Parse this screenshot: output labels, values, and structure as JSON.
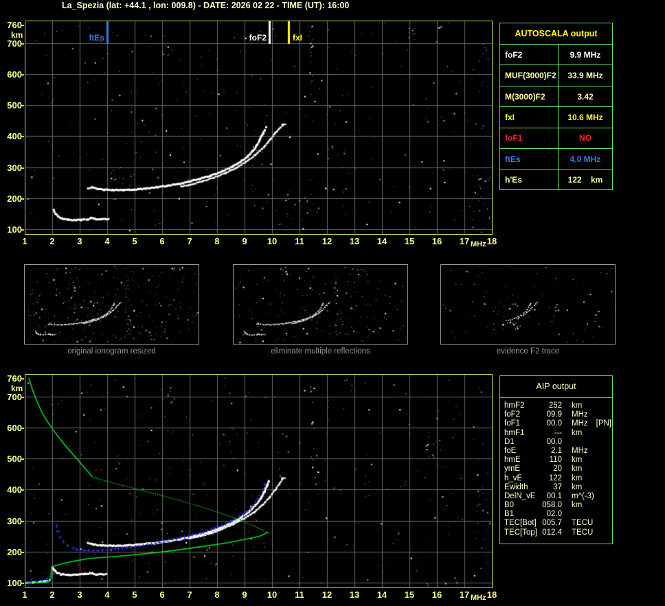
{
  "title": "La_Spezia (lat: +44.1 , lon: 009.8) - DATE: 2026 02 22 - TIME (UT): 16:00",
  "colors": {
    "background": "#000000",
    "title_text": "#ffffc8",
    "axis_text": "#ffff8c",
    "plot_border": "#d2d24a",
    "grid": "#6a6a6a",
    "table_border": "#63e763",
    "table_header_yellow": "#ffff00",
    "cream_text": "#ffffca",
    "white_text": "#ffffff",
    "red_text": "#ff2222",
    "blue_text": "#2f7fe8",
    "trace_white": "#ffffff",
    "trace_blue": "#2f3bff",
    "profile_green": "#00d922",
    "noise_gray": "#9a9a9a",
    "thumb_label_gray": "#989898"
  },
  "autoscala_table": {
    "header": "AUTOSCALA output",
    "rows": [
      {
        "label": "foF2",
        "value": "9.9 MHz",
        "color": "#ffffff"
      },
      {
        "label": "MUF(3000)F2",
        "value": "33.9 MHz",
        "color": "#ffff99"
      },
      {
        "label": "M(3000)F2",
        "value": "3.42",
        "color": "#ffff99"
      },
      {
        "label": "fxI",
        "value": "10.6 MHz",
        "color": "#ffff00"
      },
      {
        "label": "foF1",
        "value": "NO",
        "color": "#ff2222"
      },
      {
        "label": "ftEs",
        "value": "4.0 MHz",
        "color": "#2f7fe8"
      },
      {
        "label": "h'Es",
        "value": "122    km",
        "color": "#ffff99"
      }
    ]
  },
  "aip_table": {
    "header": "AIP output",
    "rows": [
      {
        "label": "hmF2",
        "value": "252",
        "unit": "km",
        "extra": ""
      },
      {
        "label": "foF2",
        "value": "09.9",
        "unit": "MHz",
        "extra": ""
      },
      {
        "label": "foF1",
        "value": "00.0",
        "unit": "MHz",
        "extra": "[PN]"
      },
      {
        "label": "hmF1",
        "value": "---",
        "unit": "km",
        "extra": ""
      },
      {
        "label": "D1",
        "value": "00.0",
        "unit": "",
        "extra": ""
      },
      {
        "label": "foE",
        "value": "2.1",
        "unit": "MHz",
        "extra": ""
      },
      {
        "label": "hmE",
        "value": "110",
        "unit": "km",
        "extra": ""
      },
      {
        "label": "ymE",
        "value": "20",
        "unit": "km",
        "extra": ""
      },
      {
        "label": "h_vE",
        "value": "122",
        "unit": "km",
        "extra": ""
      },
      {
        "label": "Ewidth",
        "value": "37",
        "unit": "km",
        "extra": ""
      },
      {
        "label": "DelN_vE",
        "value": "00.1",
        "unit": "m^(-3)",
        "extra": ""
      },
      {
        "label": "B0",
        "value": "058.0",
        "unit": "km",
        "extra": ""
      },
      {
        "label": "B1",
        "value": "02.0",
        "unit": "",
        "extra": ""
      },
      {
        "label": "TEC[Bot]",
        "value": "005.7",
        "unit": "TECU",
        "extra": ""
      },
      {
        "label": "TEC[Top]",
        "value": "012.4",
        "unit": "TECU",
        "extra": ""
      }
    ]
  },
  "thumbnails": [
    {
      "label": "original ionogram resized"
    },
    {
      "label": "eliminate multiple reflections"
    },
    {
      "label": "evidence F2 trace"
    }
  ],
  "chart_data": [
    {
      "id": "top-ionogram",
      "type": "scatter",
      "title": "scaled ionogram",
      "xlabel": "MHz",
      "ylabel": "km",
      "xlim": [
        1,
        18
      ],
      "ylim": [
        83,
        772
      ],
      "grid": true,
      "x_ticks": [
        1,
        2,
        3,
        4,
        5,
        6,
        7,
        8,
        9,
        10,
        11,
        12,
        13,
        14,
        15,
        16,
        17,
        18
      ],
      "y_ticks": [
        760,
        700,
        600,
        500,
        400,
        300,
        200,
        100
      ],
      "markers": [
        {
          "name": "ftEs",
          "label": "ftEs",
          "freq_mhz": 4.0,
          "color": "#2f7fe8",
          "label_side": "left"
        },
        {
          "name": "foF2",
          "label": "foF2",
          "freq_mhz": 9.9,
          "color": "#ffffff",
          "label_side": "left"
        },
        {
          "name": "fxI",
          "label": "fxI",
          "freq_mhz": 10.6,
          "color": "#ffff00",
          "label_side": "right"
        }
      ],
      "series": [
        {
          "name": "Es trace",
          "color": "#ffffff",
          "style": "dots",
          "width": 3,
          "points": [
            [
              2.05,
              162
            ],
            [
              2.12,
              150
            ],
            [
              2.22,
              141
            ],
            [
              2.35,
              135
            ],
            [
              2.55,
              131
            ],
            [
              2.8,
              129
            ],
            [
              3.05,
              130
            ],
            [
              3.3,
              132
            ],
            [
              3.42,
              137
            ],
            [
              3.55,
              133
            ],
            [
              3.75,
              132
            ],
            [
              4.05,
              133
            ]
          ]
        },
        {
          "name": "F2 trace O-mode",
          "color": "#ffffff",
          "style": "dots",
          "width": 3,
          "points": [
            [
              3.3,
              231
            ],
            [
              3.45,
              236
            ],
            [
              3.65,
              230
            ],
            [
              3.9,
              227
            ],
            [
              4.2,
              226
            ],
            [
              4.6,
              226
            ],
            [
              5.0,
              228
            ],
            [
              5.4,
              231
            ],
            [
              5.8,
              235
            ],
            [
              6.2,
              240
            ],
            [
              6.6,
              246
            ],
            [
              7.0,
              254
            ],
            [
              7.4,
              263
            ],
            [
              7.8,
              274
            ],
            [
              8.2,
              287
            ],
            [
              8.55,
              301
            ],
            [
              8.85,
              317
            ],
            [
              9.1,
              334
            ],
            [
              9.3,
              352
            ],
            [
              9.45,
              370
            ],
            [
              9.57,
              390
            ],
            [
              9.67,
              408
            ],
            [
              9.74,
              420
            ],
            [
              9.78,
              428
            ]
          ]
        },
        {
          "name": "F2 trace X-mode",
          "color": "#ffffff",
          "style": "dots",
          "width": 2.5,
          "points": [
            [
              6.7,
              238
            ],
            [
              7.1,
              245
            ],
            [
              7.5,
              255
            ],
            [
              7.9,
              267
            ],
            [
              8.3,
              281
            ],
            [
              8.7,
              298
            ],
            [
              9.05,
              317
            ],
            [
              9.4,
              340
            ],
            [
              9.7,
              364
            ],
            [
              9.95,
              390
            ],
            [
              10.15,
              413
            ],
            [
              10.3,
              428
            ],
            [
              10.42,
              436
            ]
          ]
        }
      ]
    },
    {
      "id": "bottom-ionogram",
      "type": "scatter",
      "title": "ionogram with restored trace and electron density profile",
      "xlabel": "MHz",
      "ylabel": "km",
      "xlim": [
        1,
        18
      ],
      "ylim": [
        83,
        772
      ],
      "grid": true,
      "x_ticks": [
        1,
        2,
        3,
        4,
        5,
        6,
        7,
        8,
        9,
        10,
        11,
        12,
        13,
        14,
        15,
        16,
        17,
        18
      ],
      "y_ticks": [
        760,
        700,
        600,
        500,
        400,
        300,
        200,
        100
      ],
      "markers": [],
      "series": [
        {
          "name": "Es trace",
          "color": "#ffffff",
          "style": "dots",
          "width": 3,
          "points": [
            [
              2.0,
              150
            ],
            [
              2.08,
              140
            ],
            [
              2.18,
              132
            ],
            [
              2.32,
              127
            ],
            [
              2.6,
              125
            ],
            [
              2.9,
              126
            ],
            [
              3.2,
              128
            ],
            [
              3.45,
              131
            ],
            [
              3.6,
              127
            ],
            [
              3.95,
              127
            ]
          ]
        },
        {
          "name": "ground return",
          "color": "#ffffff",
          "style": "dots",
          "width": 2.5,
          "points": [
            [
              1.02,
              99
            ],
            [
              1.3,
              100
            ],
            [
              1.55,
              102
            ],
            [
              1.75,
              105
            ],
            [
              1.9,
              109
            ]
          ]
        },
        {
          "name": "F2 trace O-mode",
          "color": "#ffffff",
          "style": "dots",
          "width": 3,
          "points": [
            [
              3.3,
              227
            ],
            [
              3.5,
              223
            ],
            [
              3.8,
              220
            ],
            [
              4.2,
              219
            ],
            [
              4.7,
              220
            ],
            [
              5.2,
              223
            ],
            [
              5.7,
              227
            ],
            [
              6.2,
              233
            ],
            [
              6.7,
              241
            ],
            [
              7.2,
              250
            ],
            [
              7.7,
              262
            ],
            [
              8.1,
              275
            ],
            [
              8.5,
              291
            ],
            [
              8.85,
              309
            ],
            [
              9.15,
              328
            ],
            [
              9.4,
              349
            ],
            [
              9.6,
              372
            ],
            [
              9.73,
              394
            ],
            [
              9.82,
              414
            ],
            [
              9.88,
              428
            ]
          ]
        },
        {
          "name": "F2 trace X-mode",
          "color": "#ffffff",
          "style": "dots",
          "width": 2.5,
          "points": [
            [
              7.0,
              242
            ],
            [
              7.4,
              250
            ],
            [
              7.8,
              260
            ],
            [
              8.2,
              273
            ],
            [
              8.6,
              289
            ],
            [
              9.0,
              307
            ],
            [
              9.35,
              327
            ],
            [
              9.65,
              350
            ],
            [
              9.9,
              374
            ],
            [
              10.1,
              397
            ],
            [
              10.28,
              420
            ],
            [
              10.4,
              435
            ]
          ]
        },
        {
          "name": "restored trace E (blue)",
          "color": "#2f3bff",
          "style": "cross",
          "points": [
            [
              1.0,
              102
            ],
            [
              1.2,
              103
            ],
            [
              1.42,
              105
            ],
            [
              1.62,
              109
            ],
            [
              1.8,
              114
            ],
            [
              1.95,
              122
            ],
            [
              2.03,
              132
            ]
          ]
        },
        {
          "name": "restored trace F (blue)",
          "color": "#2f3bff",
          "style": "cross",
          "points": [
            [
              2.15,
              283
            ],
            [
              2.2,
              266
            ],
            [
              2.28,
              248
            ],
            [
              2.4,
              233
            ],
            [
              2.55,
              221
            ],
            [
              2.75,
              212
            ],
            [
              3.0,
              206
            ],
            [
              3.3,
              203
            ],
            [
              3.65,
              204
            ],
            [
              4.0,
              207
            ],
            [
              4.4,
              211
            ],
            [
              4.85,
              216
            ],
            [
              5.3,
              222
            ],
            [
              5.75,
              229
            ],
            [
              6.2,
              236
            ],
            [
              6.65,
              245
            ],
            [
              7.1,
              254
            ],
            [
              7.5,
              264
            ],
            [
              7.9,
              276
            ],
            [
              8.3,
              290
            ],
            [
              8.65,
              306
            ],
            [
              8.95,
              322
            ],
            [
              9.2,
              340
            ],
            [
              9.4,
              360
            ],
            [
              9.55,
              380
            ],
            [
              9.65,
              400
            ],
            [
              9.72,
              418
            ]
          ]
        },
        {
          "name": "N(h) profile topside",
          "color": "#00d922",
          "style": "line",
          "points": [
            [
              1.15,
              760
            ],
            [
              1.28,
              723
            ],
            [
              1.42,
              690
            ],
            [
              1.58,
              658
            ],
            [
              1.77,
              627
            ],
            [
              2.0,
              597
            ],
            [
              2.25,
              567
            ],
            [
              2.5,
              540
            ],
            [
              2.75,
              514
            ],
            [
              3.0,
              489
            ],
            [
              3.2,
              468
            ],
            [
              3.38,
              450
            ],
            [
              3.45,
              442
            ]
          ]
        },
        {
          "name": "N(h) profile topside dotted",
          "color": "#00d922",
          "style": "dotted-line",
          "points": [
            [
              3.45,
              442
            ],
            [
              3.9,
              430
            ],
            [
              4.5,
              416
            ],
            [
              5.2,
              400
            ],
            [
              5.9,
              384
            ],
            [
              6.6,
              367
            ],
            [
              7.3,
              349
            ],
            [
              8.0,
              329
            ],
            [
              8.7,
              307
            ],
            [
              9.3,
              285
            ],
            [
              9.65,
              271
            ],
            [
              9.85,
              262
            ]
          ]
        },
        {
          "name": "N(h) profile bottomside",
          "color": "#00d922",
          "style": "line",
          "points": [
            [
              9.85,
              262
            ],
            [
              9.55,
              250
            ],
            [
              9.1,
              241
            ],
            [
              8.4,
              229
            ],
            [
              7.6,
              218
            ],
            [
              6.7,
              207
            ],
            [
              5.8,
              197
            ],
            [
              4.9,
              189
            ],
            [
              4.1,
              183
            ],
            [
              3.35,
              178
            ],
            [
              2.9,
              171
            ],
            [
              2.5,
              164
            ],
            [
              2.2,
              157
            ],
            [
              2.0,
              152
            ],
            [
              1.97,
              142
            ],
            [
              1.96,
              128
            ],
            [
              1.95,
              115
            ],
            [
              1.93,
              106
            ],
            [
              1.8,
              102
            ],
            [
              1.55,
              100
            ],
            [
              1.3,
              99
            ],
            [
              1.05,
              99
            ]
          ]
        }
      ]
    }
  ]
}
